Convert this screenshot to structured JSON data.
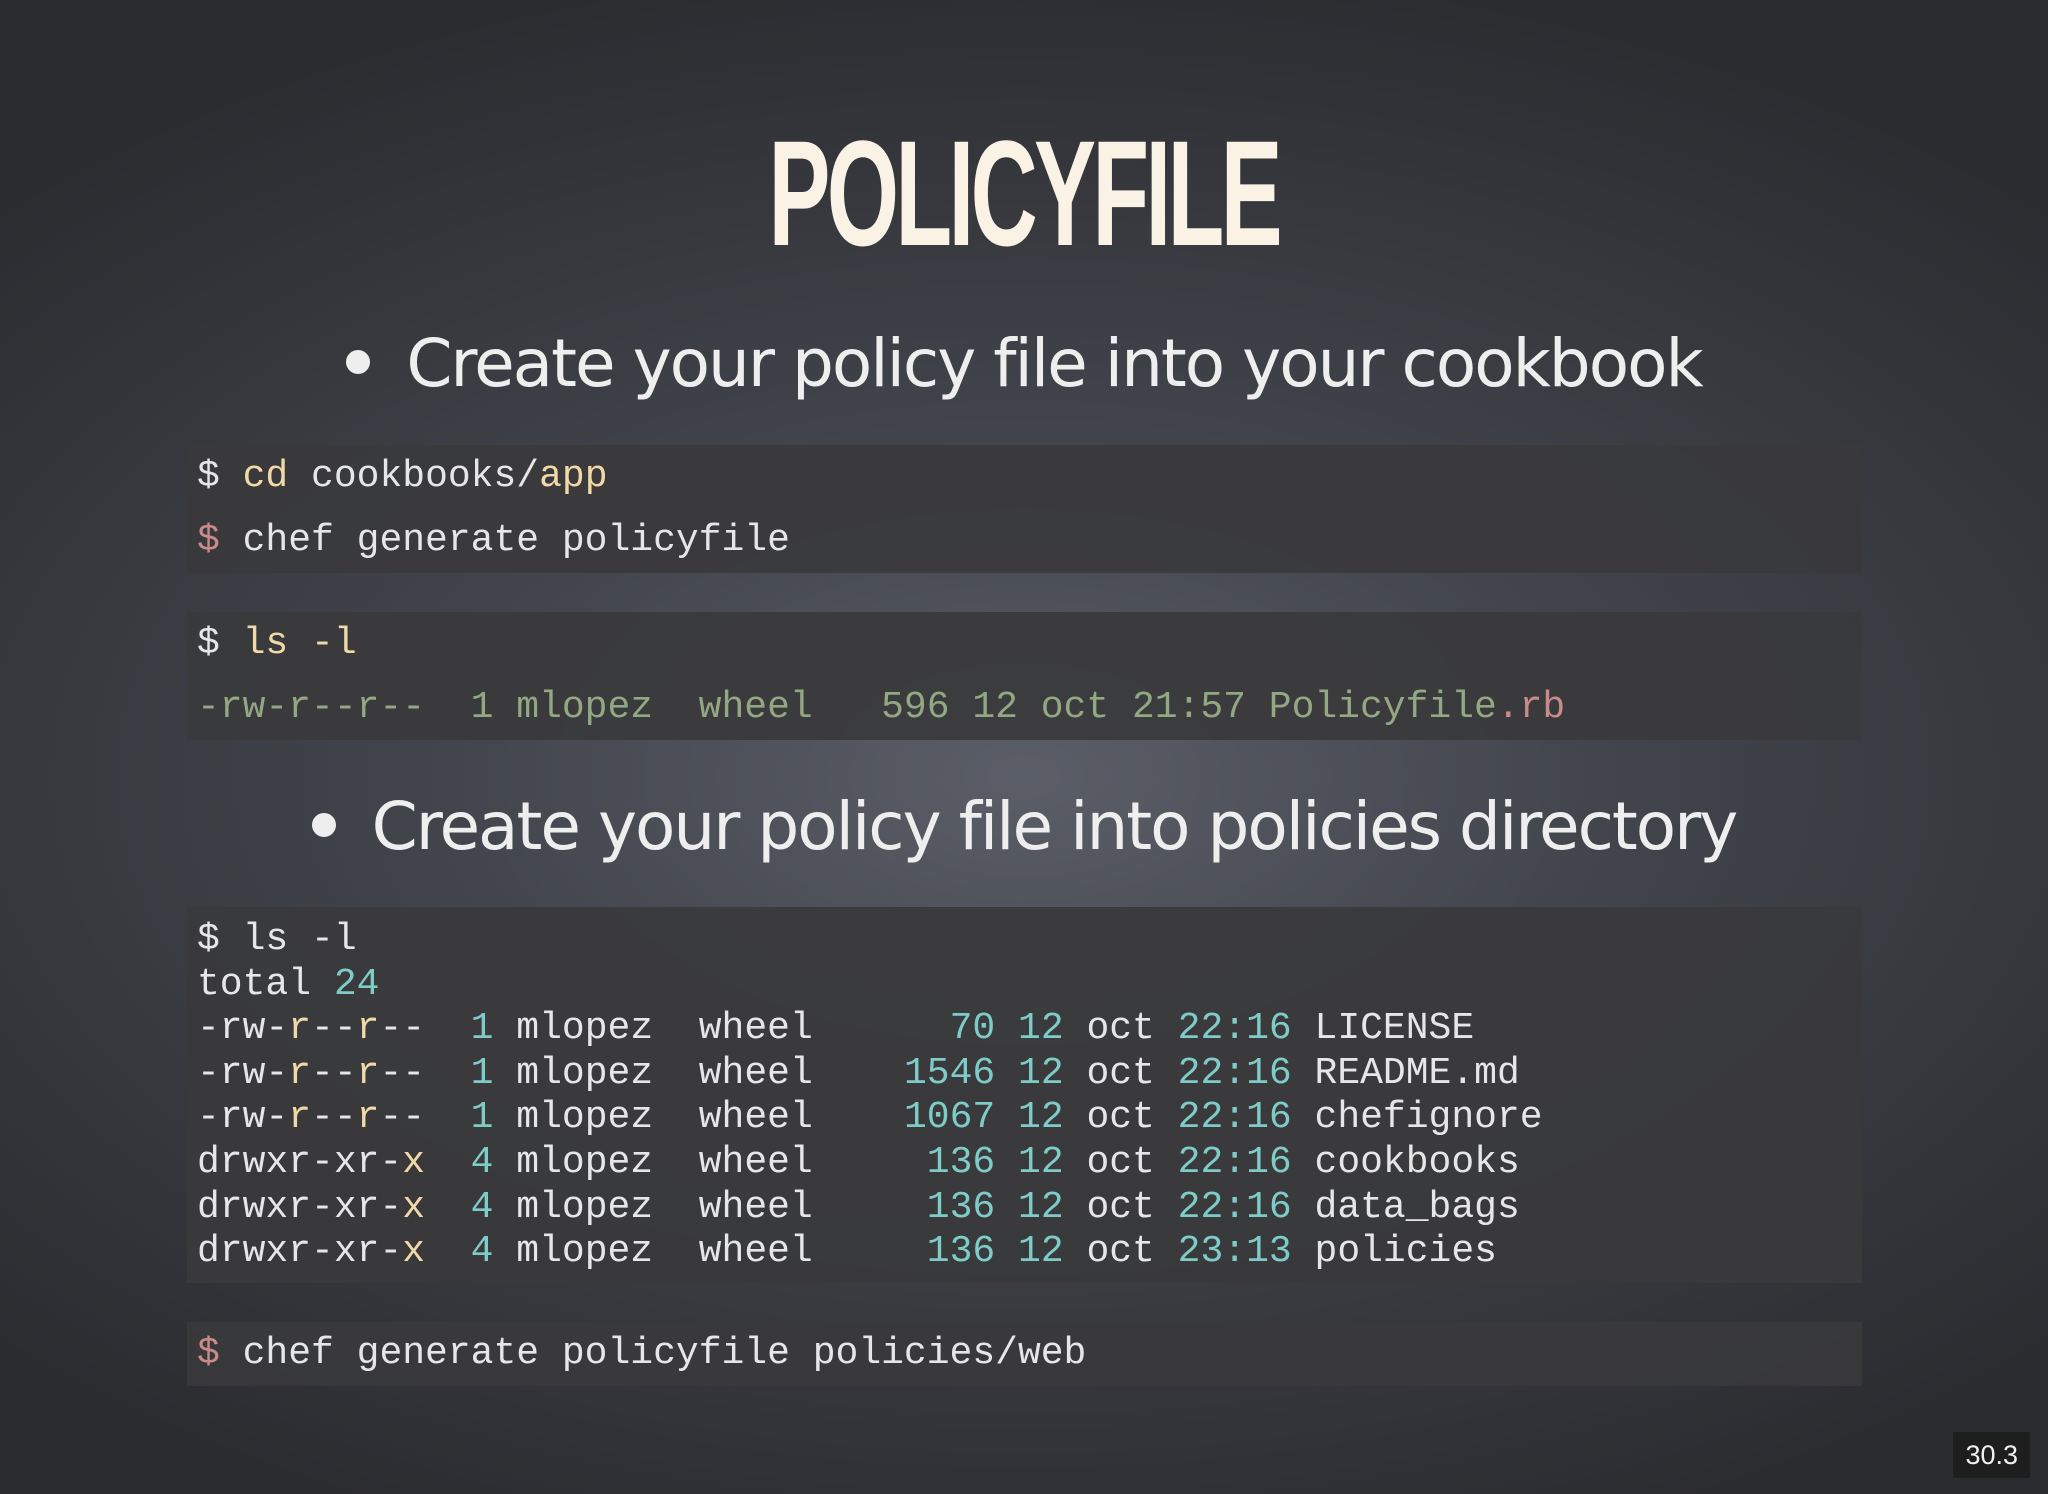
{
  "slide": {
    "title": "POLICYFILE",
    "bullets": [
      "Create your policy file into your cookbook",
      "Create your policy file into policies directory"
    ],
    "block1": {
      "line1": {
        "prompt": "$",
        "cmd": "cd",
        "path": "cookbooks/",
        "arg": "app"
      },
      "line2": {
        "prompt": "$",
        "text": "chef generate policyfile"
      }
    },
    "block2": {
      "line1": {
        "prompt": "$",
        "cmd": "ls -l"
      },
      "line2": {
        "text": "-rw-r--r--  1 mlopez  wheel   596 12 oct 21:57 Policyfile",
        "ext": ".rb"
      }
    },
    "block3": {
      "cmd": "$ ls -l",
      "total_label": "total",
      "total_value": "24",
      "rows": [
        {
          "perm_a": "-rw-",
          "perm_b": "r",
          "perm_c": "--",
          "perm_d": "r",
          "perm_e": "--",
          "links": "1",
          "owner": "mlopez",
          "group": "wheel",
          "size": "70",
          "day": "12",
          "month": "oct",
          "time": "22:16",
          "name": "LICENSE"
        },
        {
          "perm_a": "-rw-",
          "perm_b": "r",
          "perm_c": "--",
          "perm_d": "r",
          "perm_e": "--",
          "links": "1",
          "owner": "mlopez",
          "group": "wheel",
          "size": "1546",
          "day": "12",
          "month": "oct",
          "time": "22:16",
          "name": "README.md"
        },
        {
          "perm_a": "-rw-",
          "perm_b": "r",
          "perm_c": "--",
          "perm_d": "r",
          "perm_e": "--",
          "links": "1",
          "owner": "mlopez",
          "group": "wheel",
          "size": "1067",
          "day": "12",
          "month": "oct",
          "time": "22:16",
          "name": "chefignore"
        },
        {
          "perm_a": "drwxr-xr-",
          "perm_b": "x",
          "perm_c": "",
          "perm_d": "",
          "perm_e": "",
          "links": "4",
          "owner": "mlopez",
          "group": "wheel",
          "size": "136",
          "day": "12",
          "month": "oct",
          "time": "22:16",
          "name": "cookbooks"
        },
        {
          "perm_a": "drwxr-xr-",
          "perm_b": "x",
          "perm_c": "",
          "perm_d": "",
          "perm_e": "",
          "links": "4",
          "owner": "mlopez",
          "group": "wheel",
          "size": "136",
          "day": "12",
          "month": "oct",
          "time": "22:16",
          "name": "data_bags"
        },
        {
          "perm_a": "drwxr-xr-",
          "perm_b": "x",
          "perm_c": "",
          "perm_d": "",
          "perm_e": "",
          "links": "4",
          "owner": "mlopez",
          "group": "wheel",
          "size": "136",
          "day": "12",
          "month": "oct",
          "time": "23:13",
          "name": "policies"
        }
      ]
    },
    "block4": {
      "prompt": "$",
      "text": "chef generate policyfile policies/web"
    },
    "slide_number": "30.3"
  }
}
